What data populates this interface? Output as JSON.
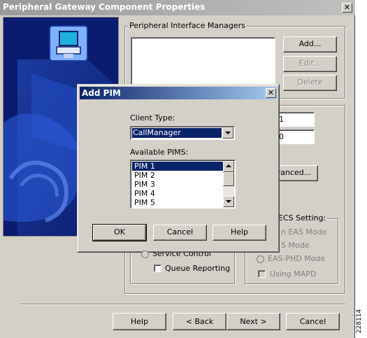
{
  "main_window": {
    "title": "Peripheral Gateway Component Properties",
    "close_glyph": "✕"
  },
  "pim_group": {
    "label": "Peripheral Interface Managers",
    "add_button": "Add...",
    "edit_button": "Edit...",
    "delete_button": "Delete"
  },
  "partial_fields": {
    "field1_value": "1",
    "field2_value": "0",
    "advanced_button": "vanced..."
  },
  "ecs_group": {
    "label": "ECS Setting:",
    "eas_mode": "n EAS Mode",
    "s_mode": "S Mode",
    "eas_phd_mode": "EAS-PHD Mode",
    "using_mapd": "Using MAPD"
  },
  "options": {
    "service_control": "Service Control",
    "queue_reporting": "Queue Reporting"
  },
  "footer": {
    "help_button": "Help",
    "back_button": "< Back",
    "next_button": "Next >",
    "cancel_button": "Cancel"
  },
  "figure_id": "228114",
  "add_pim_dialog": {
    "title": "Add PIM",
    "close_glyph": "✕",
    "client_type_label": "Client Type:",
    "client_type_value": "CallManager",
    "available_label": "Available PIMS:",
    "available_pims": [
      "PIM 1",
      "PIM 2",
      "PIM 3",
      "PIM 4",
      "PIM 5"
    ],
    "selected_pim": "PIM 1",
    "ok_button": "OK",
    "cancel_button": "Cancel",
    "help_button": "Help"
  }
}
